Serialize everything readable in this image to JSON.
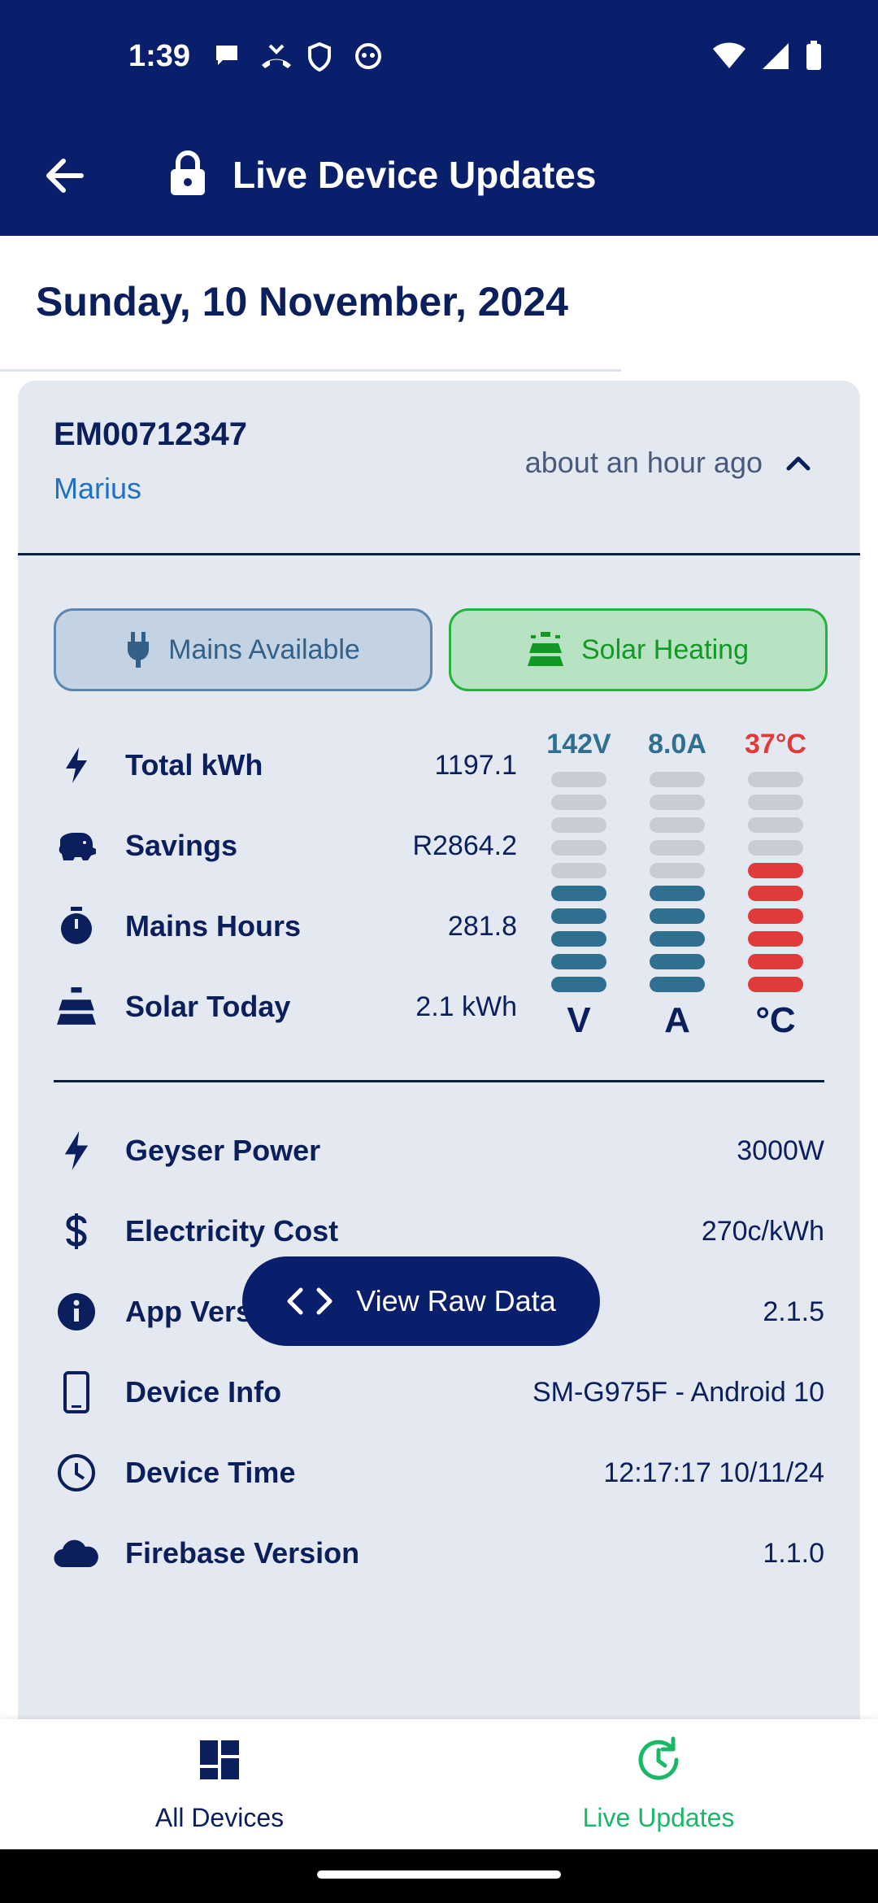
{
  "status_bar": {
    "time": "1:39"
  },
  "app_bar": {
    "title": "Live Device Updates"
  },
  "date_heading": "Sunday, 10 November, 2024",
  "device": {
    "id": "EM00712347",
    "owner": "Marius",
    "last_seen": "about an hour ago",
    "status_pills": {
      "mains": "Mains Available",
      "solar": "Solar Heating"
    },
    "stats": [
      {
        "label": "Total kWh",
        "value": "1197.1",
        "icon": "bolt-icon"
      },
      {
        "label": "Savings",
        "value": "R2864.2",
        "icon": "piggy-bank-icon"
      },
      {
        "label": "Mains Hours",
        "value": "281.8",
        "icon": "stopwatch-icon"
      },
      {
        "label": "Solar Today",
        "value": "2.1 kWh",
        "icon": "solar-panel-icon"
      }
    ],
    "meters": [
      {
        "reading": "142V",
        "unit": "V",
        "level": 5,
        "total": 10,
        "color": "#2f6f8f"
      },
      {
        "reading": "8.0A",
        "unit": "A",
        "level": 5,
        "total": 10,
        "color": "#2f6f8f"
      },
      {
        "reading": "37°C",
        "unit": "°C",
        "level": 6,
        "total": 10,
        "color": "#e03a3a"
      }
    ],
    "info": [
      {
        "label": "Geyser Power",
        "value": "3000W",
        "icon": "bolt-icon"
      },
      {
        "label": "Electricity Cost",
        "value": "270c/kWh",
        "icon": "dollar-icon"
      },
      {
        "label": "App Version",
        "value": "2.1.5",
        "icon": "info-icon"
      },
      {
        "label": "Device Info",
        "value": "SM-G975F - Android 10",
        "icon": "phone-icon"
      },
      {
        "label": "Device Time",
        "value": "12:17:17 10/11/24",
        "icon": "clock-icon"
      },
      {
        "label": "Firebase Version",
        "value": "1.1.0",
        "icon": "cloud-icon"
      }
    ],
    "raw_button": "View Raw Data"
  },
  "bottom_nav": {
    "all_devices": "All Devices",
    "live_updates": "Live Updates",
    "active_color": "#19b866"
  }
}
